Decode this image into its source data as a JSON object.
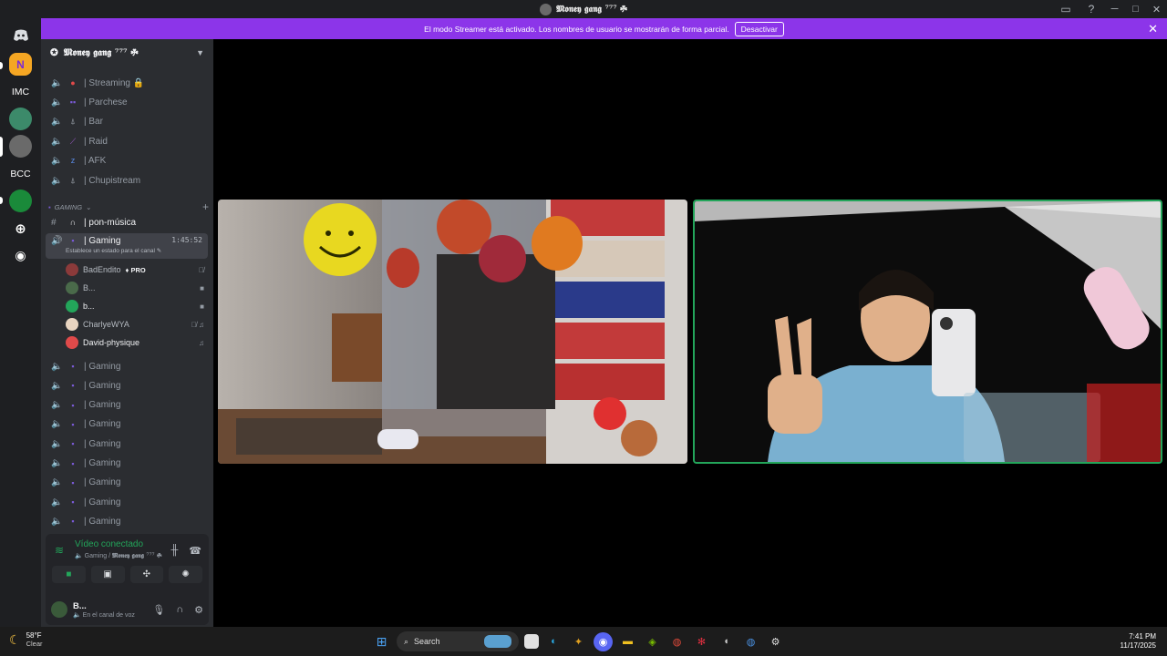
{
  "window": {
    "title": "𝕸𝖔𝖓𝖊𝖞 𝖌𝖆𝖓𝖌 ⁷⁷⁷ ☘"
  },
  "rail": {
    "servers": [
      "N",
      "IMC",
      "BCC"
    ]
  },
  "banner": {
    "text": "El modo Streamer está activado. Los nombres de usuario se mostrarán de forma parcial.",
    "button": "Desactivar"
  },
  "server_header": {
    "name": "𝕸𝖔𝖓𝖊𝖞 𝖌𝖆𝖓𝖌 ⁷⁷⁷ ☘"
  },
  "channels_top": [
    {
      "label": "| Streaming 🔒"
    },
    {
      "label": "| Parchese"
    },
    {
      "label": "| Bar"
    },
    {
      "label": "| Raid"
    },
    {
      "label": "| AFK"
    },
    {
      "label": "| Chupistream"
    }
  ],
  "category": {
    "name": "GAMING"
  },
  "text_channel": {
    "label": "| pon-música"
  },
  "active_channel": {
    "label": "| Gaming",
    "timer": "1:45:52",
    "status_hint": "Establece un estado para el canal ✎"
  },
  "members": [
    {
      "name": "BadEndito",
      "badge": "PRO",
      "icons": "🎙̸",
      "color": "#8b3a3a"
    },
    {
      "name": "B...",
      "icons": "■",
      "color": "#4a6a4a"
    },
    {
      "name": "b...",
      "icons": "■",
      "color": "#23a55a"
    },
    {
      "name": "CharlyeWYA",
      "icons": "🎙̸ ♫",
      "color": "#e8d4c0"
    },
    {
      "name": "David-physique",
      "icons": "♫",
      "color": "#e04a4a"
    }
  ],
  "gaming_channels": [
    {
      "label": "| Gaming"
    },
    {
      "label": "| Gaming"
    },
    {
      "label": "| Gaming"
    },
    {
      "label": "| Gaming"
    },
    {
      "label": "| Gaming"
    },
    {
      "label": "| Gaming"
    },
    {
      "label": "| Gaming"
    },
    {
      "label": "| Gaming"
    },
    {
      "label": "| Gaming"
    }
  ],
  "voice_panel": {
    "status": "Vídeo conectado",
    "channel": "Gaming /",
    "server": "𝕸𝖔𝖓𝖊𝖞 𝖌𝖆𝖓𝖌 ⁷⁷⁷ ☘"
  },
  "user": {
    "name": "B...",
    "status": "En el canal de voz"
  },
  "weather": {
    "temp": "58°F",
    "condition": "Clear"
  },
  "taskbar": {
    "search_label": "Search"
  },
  "clock": {
    "time": "7:41 PM",
    "date": "11/17/2025"
  }
}
